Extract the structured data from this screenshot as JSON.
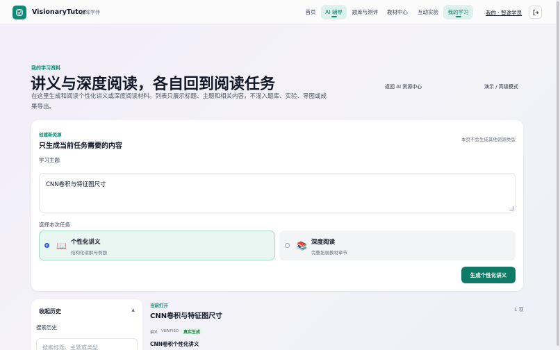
{
  "header": {
    "brand": "VisionaryTutor",
    "brand_sub": "智眸学伴",
    "nav": [
      "首页",
      "AI 辅导",
      "题库与测评",
      "教材中心",
      "互动实验",
      "我的学习"
    ],
    "user_link": "我的 · 智途学员"
  },
  "hero": {
    "eyebrow": "我的学习资料",
    "title": "讲义与深度阅读，各自回到阅读任务",
    "description": "在这里生成和阅读个性化讲义或深度阅读材料。列表只展示标题、主题和相关内容，不混入题库、实验、导图或成果导出。",
    "back_link": "返回 AI 资源中心",
    "mode_link": "演示 / 高级模式"
  },
  "create_card": {
    "eyebrow": "创建新资源",
    "title": "只生成当前任务需要的内容",
    "note": "本页不会生成其他资源类型",
    "topic_label": "学习主题",
    "topic_value": "CNN卷积与特征图尺寸",
    "task_label": "选择本次任务",
    "options": [
      {
        "title": "个性化讲义",
        "subtitle": "结构化讲解与例题",
        "selected": true,
        "icon": "book-icon"
      },
      {
        "title": "深度阅读",
        "subtitle": "完整拓展教材章节",
        "selected": false,
        "icon": "books-icon"
      }
    ],
    "submit_label": "生成个性化讲义"
  },
  "history": {
    "title": "收起历史",
    "search_label": "搜索历史",
    "search_placeholder": "搜索标题、主题或类型"
  },
  "current": {
    "eyebrow": "当前打开",
    "title": "CNN卷积与特征图尺寸",
    "count": "1 项",
    "tag_type": "讲义",
    "tag_verified": "VERIFIED",
    "tag_real": "真实生成",
    "subtitle": "CNN卷积个性化讲义"
  },
  "colors": {
    "accent": "#0f8a74",
    "primary_button": "#0f7a66",
    "selected_option_bg": "#eaf6f2"
  }
}
